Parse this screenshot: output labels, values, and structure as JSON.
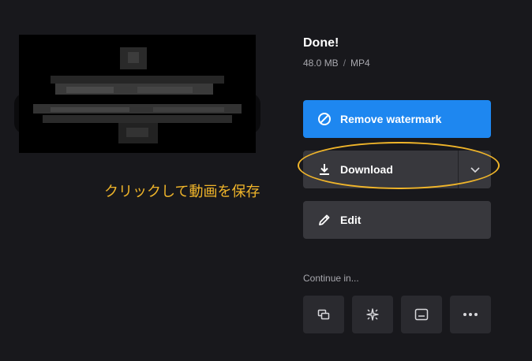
{
  "status": {
    "title": "Done!",
    "file_size": "48.0 MB",
    "separator": "/",
    "file_type": "MP4"
  },
  "actions": {
    "remove_watermark_label": "Remove watermark",
    "remove_watermark_icon": "prohibited-icon",
    "download_label": "Download",
    "download_icon": "download-icon",
    "download_menu_icon": "chevron-down-icon",
    "edit_label": "Edit",
    "edit_icon": "pencil-icon"
  },
  "annotation": {
    "text": "クリックして動画を保存",
    "color": "#f0b52a"
  },
  "continue": {
    "label": "Continue in...",
    "tools": [
      {
        "icon": "layers-icon"
      },
      {
        "icon": "sparkle-icon"
      },
      {
        "icon": "subtitles-icon"
      },
      {
        "icon": "more-icon"
      }
    ]
  },
  "colors": {
    "background": "#18181c",
    "primary": "#1e87f0",
    "secondary_button": "#38383d",
    "tool_button": "#2a2a2f"
  }
}
